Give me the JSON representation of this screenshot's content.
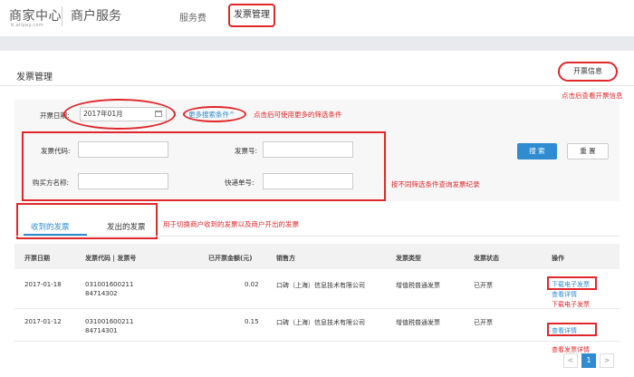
{
  "header": {
    "logo_main": "商家中心",
    "logo_sub": "b.alipay.com",
    "app_title": "商户服务",
    "nav": [
      "服务费",
      "发票管理"
    ]
  },
  "page": {
    "title": "发票管理",
    "open_button": "开票信息",
    "open_button_note": "点击后查看开票信息"
  },
  "filters": {
    "date_label": "开票日期:",
    "date_value": "2017年01月",
    "more_link": "更多搜索条件",
    "more_note": "点击后可使用更多的筛选条件",
    "invoice_code_label": "发票代码:",
    "invoice_no_label": "发票号:",
    "buyer_label": "购买方名称:",
    "express_label": "快递单号:",
    "fields_note": "按不同筛选条件查询发票纪录",
    "search_button": "搜 索",
    "reset_button": "重 置"
  },
  "tabs": {
    "received": "收到的发票",
    "issued": "发出的发票",
    "note": "用于切换商户收到的发票以及商户开出的发票"
  },
  "table": {
    "headers": [
      "开票日期",
      "发票代码 | 发票号",
      "已开票金额(元)",
      "销售方",
      "发票类型",
      "发票状态",
      "操作"
    ],
    "rows": [
      {
        "date": "2017-01-18",
        "code": "031001600211",
        "number": "84714302",
        "amount": "0.02",
        "seller": "口碑（上海）信息技术有限公司",
        "type": "增值税普通发票",
        "status": "已开票",
        "op_download": "下载电子发票",
        "op_detail": "查看详情"
      },
      {
        "date": "2017-01-12",
        "code": "031001600211",
        "number": "84714301",
        "amount": "0.15",
        "seller": "口碑（上海）信息技术有限公司",
        "type": "增值税普通发票",
        "status": "已开票",
        "op_detail": "查看详情"
      }
    ],
    "note_download": "下载电子发票",
    "note_detail": "查看发票详情"
  },
  "pager": {
    "prev": "<",
    "current": "1",
    "next": ">"
  },
  "colors": {
    "accent": "#2f8cd0",
    "annotation": "#e0272a"
  }
}
